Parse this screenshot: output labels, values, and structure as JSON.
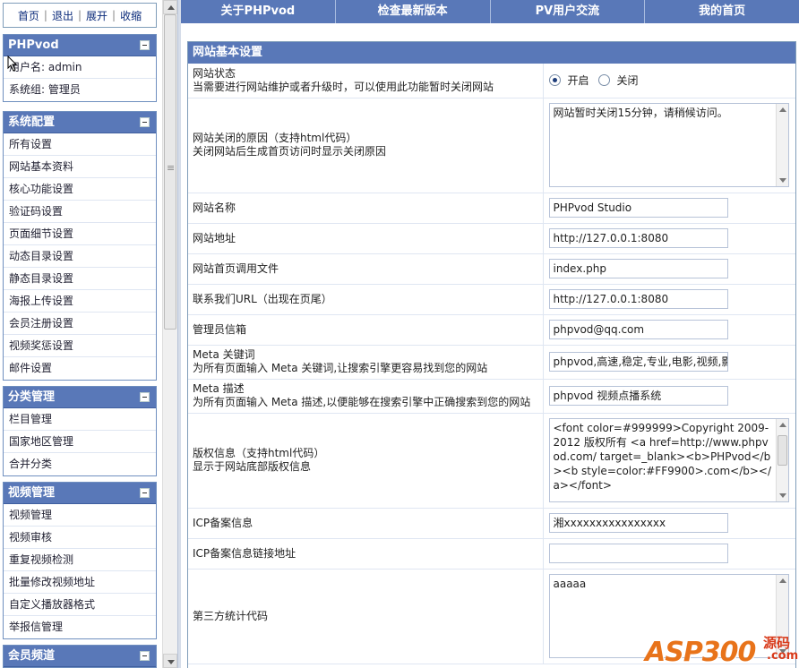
{
  "topnav": {
    "home": "首页",
    "logout": "退出",
    "expand": "展开",
    "collapse": "收缩"
  },
  "panels": {
    "phpvod": {
      "title": "PHPvod",
      "items": [
        "用户名: admin",
        "系统组: 管理员"
      ]
    },
    "system": {
      "title": "系统配置",
      "items": [
        "所有设置",
        "网站基本资料",
        "核心功能设置",
        "验证码设置",
        "页面细节设置",
        "动态目录设置",
        "静态目录设置",
        "海报上传设置",
        "会员注册设置",
        "视频奖惩设置",
        "邮件设置"
      ]
    },
    "category": {
      "title": "分类管理",
      "items": [
        "栏目管理",
        "国家地区管理",
        "合并分类"
      ]
    },
    "video": {
      "title": "视频管理",
      "items": [
        "视频管理",
        "视频审核",
        "重复视频检测",
        "批量修改视频地址",
        "自定义播放器格式",
        "举报信管理"
      ]
    },
    "member": {
      "title": "会员频道"
    }
  },
  "tabs": [
    "关于PHPvod",
    "检查最新版本",
    "PV用户交流",
    "我的首页"
  ],
  "form": {
    "title": "网站基本设置",
    "status_label": "网站状态",
    "status_desc": "当需要进行网站维护或者升级时，可以使用此功能暂时关闭网站",
    "status_on": "开启",
    "status_off": "关闭",
    "close_reason_label": "网站关闭的原因（支持html代码）",
    "close_reason_desc": "关闭网站后生成首页访问时显示关闭原因",
    "close_reason_value": "网站暂时关闭15分钟，请稍候访问。",
    "site_name_label": "网站名称",
    "site_name_value": "PHPvod Studio",
    "site_url_label": "网站地址",
    "site_url_value": "http://127.0.0.1:8080",
    "index_file_label": "网站首页调用文件",
    "index_file_value": "index.php",
    "contact_label": "联系我们URL（出现在页尾）",
    "contact_value": "http://127.0.0.1:8080",
    "admin_email_label": "管理员信箱",
    "admin_email_value": "phpvod@qq.com",
    "meta_kw_label": "Meta 关键词",
    "meta_kw_desc": "为所有页面输入  Meta 关键词,让搜索引擎更容易找到您的网站",
    "meta_kw_value": "phpvod,高速,稳定,专业,电影,视频,影",
    "meta_desc_label": "Meta 描述",
    "meta_desc_desc": "为所有页面输入  Meta 描述,以便能够在搜索引擎中正确搜索到您的网站",
    "meta_desc_value": "phpvod 视频点播系统",
    "copyright_label": "版权信息（支持html代码）",
    "copyright_desc": "显示于网站底部版权信息",
    "copyright_value": "<font color=#999999>Copyright 2009-2012 版权所有  <a href=http://www.phpvod.com/ target=_blank><b>PHPvod</b><b style=color:#FF9900>.com</b></a></font>",
    "icp_label": "ICP备案信息",
    "icp_value": "湘xxxxxxxxxxxxxxxx",
    "icp_link_label": "ICP备案信息链接地址",
    "icp_link_value": "",
    "stats_label": "第三方统计代码",
    "stats_value": "aaaaa"
  },
  "watermark": {
    "word": "ASP300",
    "src": "源码",
    "com": ".com"
  }
}
